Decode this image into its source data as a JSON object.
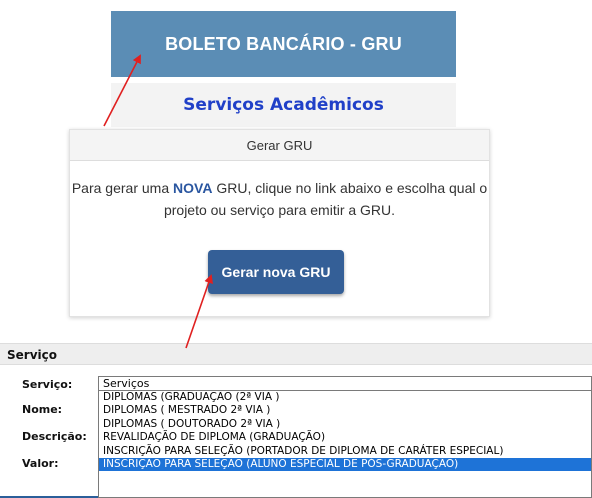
{
  "header": {
    "title": "BOLETO BANCÁRIO - GRU",
    "subtitle": "Serviços Acadêmicos"
  },
  "gru_panel": {
    "heading": "Gerar GRU",
    "text_before": "Para gerar uma ",
    "text_highlight": "NOVA",
    "text_after_line1": " GRU, clique no link abaixo e escolha qual o",
    "text_line2": "projeto ou serviço para emitir a GRU.",
    "button_label": "Gerar nova GRU"
  },
  "servico_form": {
    "section_title": "Serviço",
    "labels": {
      "servico": "Serviço:",
      "nome": "Nome:",
      "descricao": "Descrição:",
      "valor": "Valor:"
    },
    "selected_value": "Serviços",
    "options": [
      "DIPLOMAS (GRADUAÇÃO (2ª VIA )",
      "DIPLOMAS ( MESTRADO 2ª VIA )",
      "DIPLOMAS ( DOUTORADO 2ª VIA )",
      "REVALIDAÇÃO DE DIPLOMA (GRADUAÇÃO)",
      "INSCRIÇÃO PARA SELEÇÃO (PORTADOR DE DIPLOMA DE CARÁTER ESPECIAL)",
      "INSCRIÇÃO PARA SELEÇÃO (ALUNO ESPECIAL DE PÓS-GRADUAÇÃO)"
    ],
    "highlighted_option_index": 5
  },
  "colors": {
    "header_bg": "#5b8db5",
    "subtitle": "#2040c8",
    "button_bg": "#345f97",
    "annotation_arrow": "#e02020",
    "option_highlight": "#1e73d7"
  }
}
